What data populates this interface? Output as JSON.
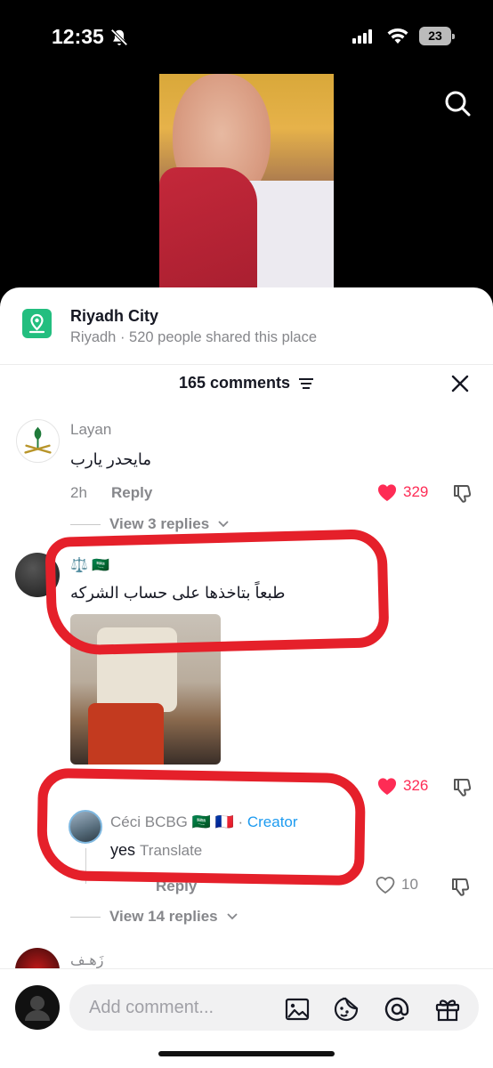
{
  "status_bar": {
    "time": "12:35",
    "battery": "23"
  },
  "location": {
    "title": "Riyadh City",
    "subtitle": "Riyadh · 520 people shared this place"
  },
  "comments_header": {
    "count_label": "165 comments"
  },
  "comments": [
    {
      "username": "Layan",
      "text": "مايحدر يارب",
      "time": "2h",
      "reply_label": "Reply",
      "likes": "329",
      "view_replies": "View 3 replies"
    },
    {
      "username_emoji": "⚖️ 🇸🇦",
      "text": "طبعاً بتاخذها على حساب الشركه",
      "likes": "326",
      "reply": {
        "username": "Céci BCBG 🇸🇦 🇫🇷",
        "creator_label": "Creator",
        "separator": "·",
        "text": "yes",
        "translate_label": "Translate",
        "reply_label": "Reply",
        "likes": "10"
      },
      "view_replies": "View 14 replies"
    },
    {
      "username": "زَهـف"
    }
  ],
  "composer": {
    "placeholder": "Add comment..."
  },
  "colors": {
    "accent": "#fe2c55",
    "creator": "#1d9bf0",
    "place_icon": "#23be7f",
    "annotation": "#e5202a"
  }
}
